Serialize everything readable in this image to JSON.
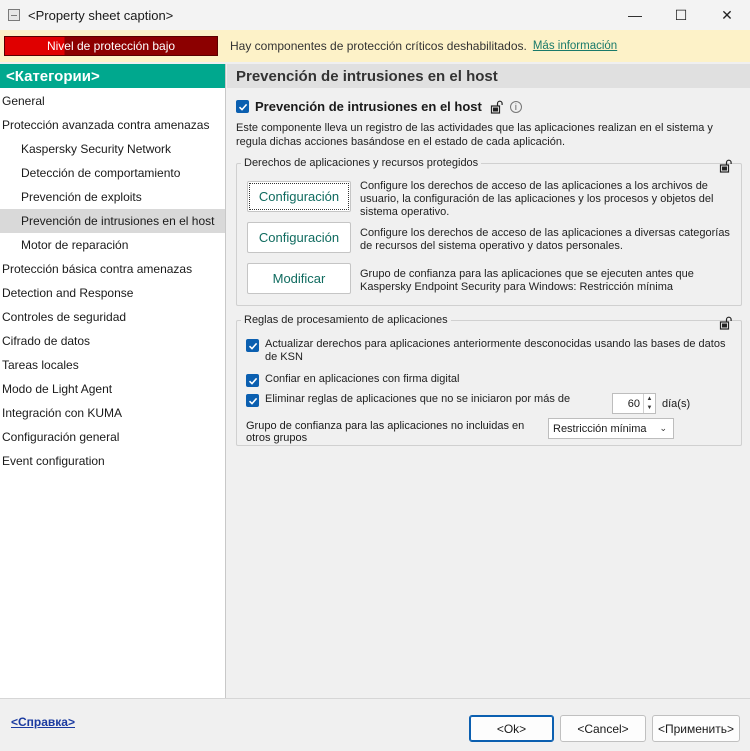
{
  "window": {
    "title": "<Property sheet caption>",
    "minimize_glyph": "—",
    "maximize_glyph": "☐",
    "close_glyph": "✕"
  },
  "warning": {
    "level": "Nivel de protección bajo",
    "message": "Hay componentes de protección críticos deshabilitados.",
    "link": "Más información"
  },
  "sidebar": {
    "header": "<Категории>",
    "items": [
      {
        "label": "General",
        "sub": false
      },
      {
        "label": "Protección avanzada contra amenazas",
        "sub": false
      },
      {
        "label": "Kaspersky Security Network",
        "sub": true
      },
      {
        "label": "Detección de comportamiento",
        "sub": true
      },
      {
        "label": "Prevención de exploits",
        "sub": true
      },
      {
        "label": "Prevención de intrusiones en el host",
        "sub": true,
        "selected": true
      },
      {
        "label": "Motor de reparación",
        "sub": true
      },
      {
        "label": "Protección básica contra amenazas",
        "sub": false
      },
      {
        "label": "Detection and Response",
        "sub": false
      },
      {
        "label": "Controles de seguridad",
        "sub": false
      },
      {
        "label": "Cifrado de datos",
        "sub": false
      },
      {
        "label": "Tareas locales",
        "sub": false
      },
      {
        "label": "Modo de Light Agent",
        "sub": false
      },
      {
        "label": "Integración con KUMA",
        "sub": false
      },
      {
        "label": "Configuración general",
        "sub": false
      },
      {
        "label": "Event configuration",
        "sub": false
      }
    ]
  },
  "main": {
    "header": "Prevención de intrusiones en el host",
    "component": {
      "title": "Prevención de intrusiones en el host",
      "checked": true,
      "info_glyph": "i",
      "description": "Este componente lleva un registro de las actividades que las aplicaciones realizan en el sistema y regula dichas acciones basándose en el estado de cada aplicación."
    },
    "rights_group": {
      "legend": "Derechos de aplicaciones y recursos protegidos",
      "rows": [
        {
          "button": "Configuración",
          "description": "Configure los derechos de acceso de las aplicaciones a los archivos de usuario, la configuración de las aplicaciones y los procesos y objetos del sistema operativo."
        },
        {
          "button": "Configuración",
          "description": "Configure los derechos de acceso de las aplicaciones a diversas categorías de recursos del sistema operativo y datos personales."
        },
        {
          "button": "Modificar",
          "description": "Grupo de confianza para las aplicaciones que se ejecuten antes que Kaspersky Endpoint Security para Windows: Restricción mínima"
        }
      ]
    },
    "rules_group": {
      "legend": "Reglas de procesamiento de aplicaciones",
      "update_ksn": "Actualizar derechos para aplicaciones anteriormente desconocidas usando las bases de datos de KSN",
      "trust_signed": "Confiar en aplicaciones con firma digital",
      "delete_rules": "Eliminar reglas de aplicaciones que no se iniciaron por más de",
      "days_value": "60",
      "days_unit": "día(s)",
      "spin_up": "▲",
      "spin_down": "▼",
      "trust_group_label": "Grupo de confianza para las aplicaciones no incluidas en otros grupos",
      "trust_group_value": "Restricción mínima",
      "chevron": "⌄"
    }
  },
  "footer": {
    "help": "<Справка>",
    "ok": "<Ok>",
    "cancel": "<Cancel>",
    "apply": "<Применить>"
  },
  "colors": {
    "accent": "#00a88e",
    "checkbox": "#0b5fb0",
    "warning_bg": "#fdf2c8",
    "danger": "#e00000"
  }
}
